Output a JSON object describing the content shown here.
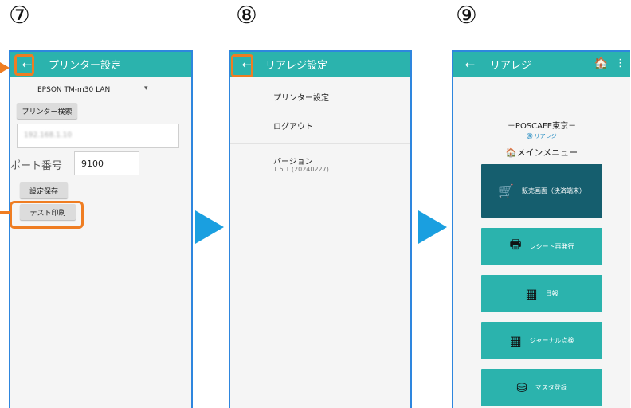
{
  "steps": [
    "⑦",
    "⑧",
    "⑨"
  ],
  "colors": {
    "teal": "#2bb3ad",
    "dark_teal": "#155e6e",
    "highlight": "#ef7d22",
    "arrow": "#1a9fe0",
    "frame": "#2e86de"
  },
  "screen1": {
    "title": "プリンター設定",
    "printer_select": "EPSON TM-m30 LAN",
    "search_button": "プリンター検索",
    "ip_value": "192.168.1.10",
    "port_label": "ポート番号",
    "port_value": "9100",
    "save_button": "設定保存",
    "test_print_button": "テスト印刷"
  },
  "screen2": {
    "title": "リアレジ設定",
    "items": [
      "プリンター設定",
      "ログアウト",
      "バージョン"
    ],
    "version": "1.5.1 (20240227)"
  },
  "screen3": {
    "title": "リアレジ",
    "store_name": "－POSCAFE東京－",
    "logo_text": "リアレジ",
    "menu_title": "メインメニュー",
    "buttons": [
      "販売画面（決済端末）",
      "レシート再発行",
      "日報",
      "ジャーナル点検",
      "マスタ登録"
    ]
  }
}
